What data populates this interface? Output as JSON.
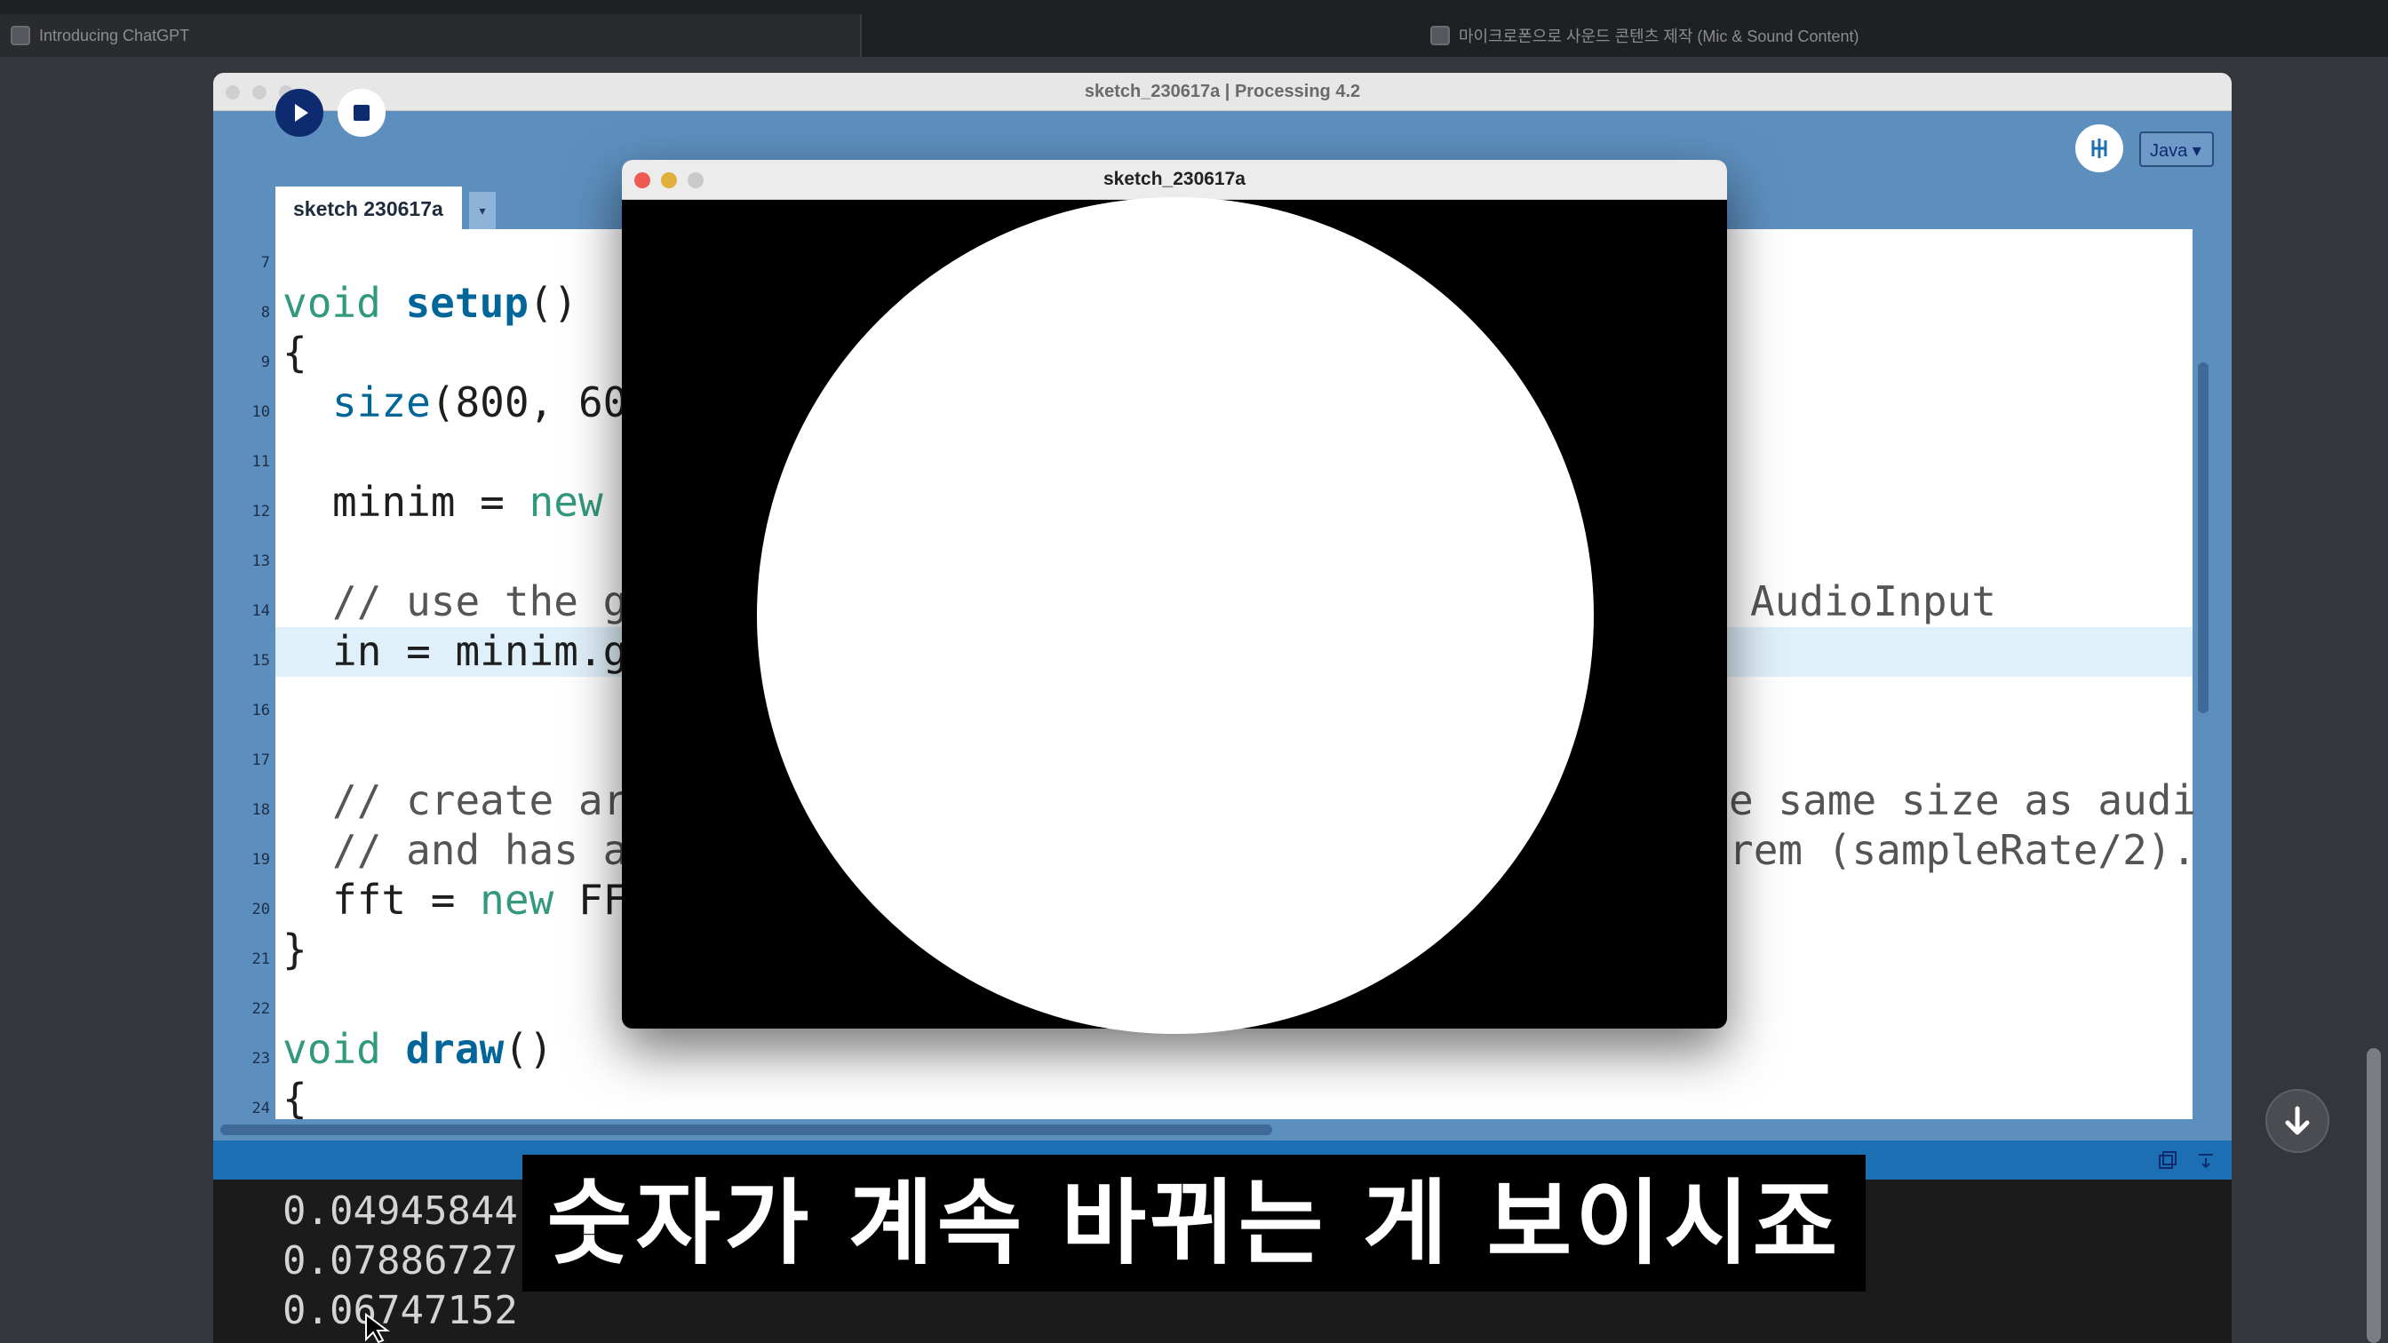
{
  "browser": {
    "tabs": [
      {
        "label": "Introducing ChatGPT"
      },
      {
        "label": "마이크로폰으로 사운드 콘텐츠 제작 (Mic & Sound Content)"
      }
    ]
  },
  "ide": {
    "title": "sketch_230617a | Processing 4.2",
    "mode": "Java ▾",
    "tab_name": "sketch 230617a",
    "tab_menu": "▾"
  },
  "code_lines": [
    {
      "num": "7"
    },
    {
      "num": "8"
    },
    {
      "num": "9"
    },
    {
      "num": "10"
    },
    {
      "num": "11"
    },
    {
      "num": "12"
    },
    {
      "num": "13"
    },
    {
      "num": "14"
    },
    {
      "num": "15"
    },
    {
      "num": "16"
    },
    {
      "num": "17"
    },
    {
      "num": "18"
    },
    {
      "num": "19"
    },
    {
      "num": "20"
    },
    {
      "num": "21"
    },
    {
      "num": "22"
    },
    {
      "num": "23"
    },
    {
      "num": "24"
    }
  ],
  "code": {
    "l8_kw": "void",
    "l8_fn": "setup",
    "l8_rest": "()",
    "l9": "{",
    "l10_fn": "size",
    "l10_rest": "(800, 60",
    "l12_a": "minim = ",
    "l12_kw": "new",
    "l14_left": "// use the g",
    "l14_right": "AudioInput",
    "l15": "in = minim.g",
    "l18_left": "// create ar",
    "l18_right": "e same size as audi",
    "l19_left": "// and has a",
    "l19_right": "rem (sampleRate/2).",
    "l20_a": "fft = ",
    "l20_kw": "new",
    "l20_b": " FF",
    "l21": "}",
    "l23_kw": "void",
    "l23_fn": "draw",
    "l23_rest": "()",
    "l24": "{"
  },
  "console": {
    "lines": [
      "0.04945844",
      "0.07886727",
      "0.06747152"
    ]
  },
  "sketch_window": {
    "title": "sketch_230617a"
  },
  "subtitle": "숫자가 계속 바뀌는 게 보이시죠",
  "colors": {
    "ide_blue": "#5d8fbe",
    "run_button": "#0f2b6f",
    "keyword": "#33997e",
    "function": "#006699",
    "highlight_line": "#e0f0fb"
  }
}
